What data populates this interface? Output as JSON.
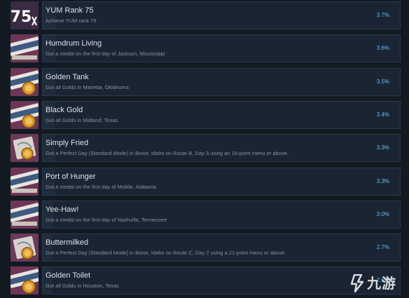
{
  "achievements": [
    {
      "title": "YUM Rank 75",
      "desc": "Achieve YUM rank 75",
      "percent": "3.7%",
      "fraction": 0.037,
      "icon": "rank-75-badge-icon",
      "badge_text": "75"
    },
    {
      "title": "Humdrum Living",
      "desc": "Got a medal on the first day of Jackson, Mississippi",
      "percent": "3.6%",
      "fraction": 0.036,
      "icon": "jackson-sign-icon",
      "badge_text": "METRO"
    },
    {
      "title": "Golden Tank",
      "desc": "Got all Golds in Marietta, Oklahoma",
      "percent": "3.5%",
      "fraction": 0.035,
      "icon": "marietta-gold-medal-icon",
      "badge_text": "LOVE COUNTY"
    },
    {
      "title": "Black Gold",
      "desc": "Got all Golds in Midland, Texas",
      "percent": "3.4%",
      "fraction": 0.034,
      "icon": "midland-gold-medal-icon",
      "badge_text": "MIDLAND"
    },
    {
      "title": "Simply Fried",
      "desc": "Got a Perfect Day (Standard Mode) in Boise, Idaho on Route B, Day 3 using an 18-point menu or above.",
      "percent": "3.3%",
      "fraction": 0.033,
      "icon": "boise-perfect-day-medal-icon",
      "badge_text": ""
    },
    {
      "title": "Port of Hunger",
      "desc": "Got a medal on the first day of Mobile, Alabama",
      "percent": "3.3%",
      "fraction": 0.033,
      "icon": "mobile-sign-icon",
      "badge_text": "DRYDOCK"
    },
    {
      "title": "Yee-Haw!",
      "desc": "Got a medal on the first day of Nashville, Tennessee",
      "percent": "3.0%",
      "fraction": 0.03,
      "icon": "nashville-sign-icon",
      "badge_text": "DAVIDSON COUNTY"
    },
    {
      "title": "Buttermilked",
      "desc": "Got a Perfect Day (Standard Mode) in Boise, Idaho on Route C, Day 2 using a 21-point menu or above.",
      "percent": "2.7%",
      "fraction": 0.027,
      "icon": "boise-perfect-day-medal-icon",
      "badge_text": ""
    },
    {
      "title": "Golden Toilet",
      "desc": "Got all Golds in Houston, Texas",
      "percent": "2.6%",
      "fraction": 0.026,
      "icon": "houston-gold-medal-icon",
      "badge_text": "GRANDVIEW"
    }
  ],
  "watermark": {
    "text": "九游",
    "icon": "jiuyou-logo-icon"
  },
  "colors": {
    "background": "#131a22",
    "panel": "#1a2433",
    "percent": "#66c0f4",
    "title": "#dfe3e6",
    "desc": "#8b9198"
  }
}
